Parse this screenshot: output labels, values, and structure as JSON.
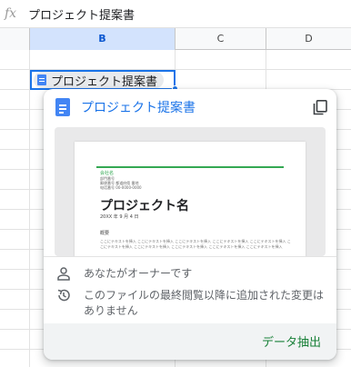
{
  "formula_bar": {
    "fx_label": "fx",
    "content": "プロジェクト提案書"
  },
  "columns": {
    "b": "B",
    "c": "C",
    "d": "D"
  },
  "cell": {
    "chip_label": "プロジェクト提案書"
  },
  "card": {
    "title": "プロジェクト提案書",
    "owner_text": "あなたがオーナーです",
    "edits_text": "このファイルの最終閲覧以降に追加された変更はありません",
    "extract_button": "データ抽出",
    "preview": {
      "company": "会社名",
      "meta_line_1": "部門番号",
      "meta_line_2": "郵便番号 都道府県 番地",
      "meta_line_3": "电话番号 00-0000-0000",
      "project_name": "プロジェクト名",
      "date": "20XX 年 9 月 4 日",
      "summary_label": "概要",
      "body_text": "ここにテキストを挿入 ここにテキストを挿入 ここにテキストを挿入 ここにテキストを挿入 ここにテキストを挿入 ここにテキストを挿入 ここにテキストを挿入 ここにテキストを挿入 ここにテキストを挿入 ここにテキストを挿入"
    }
  },
  "colors": {
    "accent": "#1a73e8",
    "green": "#188038",
    "selection": "#d3e3fd"
  },
  "icons": [
    "function-icon",
    "google-docs-icon",
    "copy-icon",
    "person-icon",
    "history-icon"
  ]
}
